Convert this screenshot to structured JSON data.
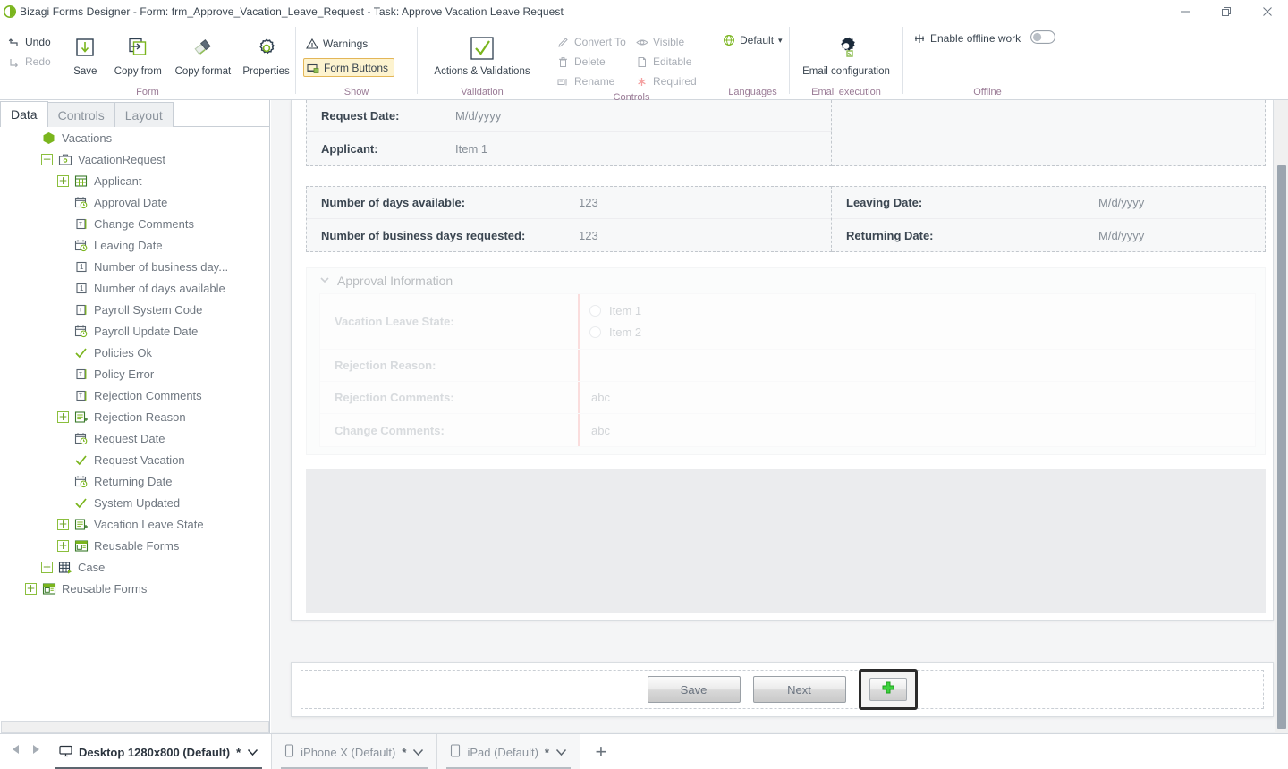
{
  "window": {
    "title": "Bizagi Forms Designer  - Form: frm_Approve_Vacation_Leave_Request - Task:  Approve Vacation Leave Request",
    "logo_icon": "bizagi-logo-icon",
    "minimize_icon": "minimize-icon",
    "restore_icon": "restore-icon",
    "close_icon": "close-icon"
  },
  "ribbon": {
    "groups": [
      {
        "label": "Form",
        "undo": "Undo",
        "redo": "Redo",
        "items": [
          {
            "label": "Save",
            "icon": "save-icon"
          },
          {
            "label": "Copy from",
            "icon": "copy-from-icon"
          },
          {
            "label": "Copy format",
            "icon": "copy-format-icon"
          },
          {
            "label": "Properties",
            "icon": "properties-gear-icon"
          }
        ]
      },
      {
        "label": "Show",
        "items": [
          {
            "label": "Warnings",
            "icon": "warning-triangle-icon"
          },
          {
            "label": "Form Buttons",
            "icon": "form-buttons-icon"
          }
        ]
      },
      {
        "label": "Validation",
        "items": [
          {
            "label": "Actions & Validations",
            "icon": "checkmark-box-icon"
          }
        ]
      },
      {
        "label": "Controls",
        "items": [
          {
            "label": "Convert To",
            "icon": "convert-to-pen-icon"
          },
          {
            "label": "Delete",
            "icon": "trash-icon"
          },
          {
            "label": "Rename",
            "icon": "rename-icon"
          },
          {
            "label": "Visible",
            "icon": "eye-icon"
          },
          {
            "label": "Editable",
            "icon": "editable-page-icon"
          },
          {
            "label": "Required",
            "icon": "asterisk-icon"
          }
        ]
      },
      {
        "label": "Languages",
        "items": [
          {
            "label": "Default",
            "icon": "globe-icon",
            "caret": "▾"
          }
        ]
      },
      {
        "label": "Email execution",
        "items": [
          {
            "label": "Email configuration",
            "icon": "email-gear-icon"
          }
        ]
      },
      {
        "label": "Offline",
        "items": [
          {
            "label": "Enable offline work",
            "icon": "offline-icon",
            "toggle": "off"
          }
        ]
      }
    ]
  },
  "left_panel": {
    "tabs": [
      {
        "label": "Data",
        "active": true
      },
      {
        "label": "Controls",
        "active": false
      },
      {
        "label": "Layout",
        "active": false
      }
    ],
    "tree": [
      {
        "label": "Vacations",
        "indent": 0,
        "expander": "",
        "icon": "entity-hex-icon"
      },
      {
        "label": "VacationRequest",
        "indent": 1,
        "expander": "-",
        "icon": "briefcase-icon"
      },
      {
        "label": "Applicant",
        "indent": 2,
        "expander": "+",
        "icon": "table-grid-icon"
      },
      {
        "label": "Approval Date",
        "indent": 2,
        "expander": "",
        "icon": "date-time-icon"
      },
      {
        "label": "Change Comments",
        "indent": 2,
        "expander": "",
        "icon": "text-field-icon"
      },
      {
        "label": "Leaving Date",
        "indent": 2,
        "expander": "",
        "icon": "date-time-icon"
      },
      {
        "label": "Number of business day...",
        "indent": 2,
        "expander": "",
        "icon": "number-icon"
      },
      {
        "label": "Number of days available",
        "indent": 2,
        "expander": "",
        "icon": "number-icon"
      },
      {
        "label": "Payroll System Code",
        "indent": 2,
        "expander": "",
        "icon": "text-field-icon"
      },
      {
        "label": "Payroll Update Date",
        "indent": 2,
        "expander": "",
        "icon": "date-time-icon"
      },
      {
        "label": "Policies Ok",
        "indent": 2,
        "expander": "",
        "icon": "boolean-check-icon"
      },
      {
        "label": "Policy Error",
        "indent": 2,
        "expander": "",
        "icon": "text-field-icon"
      },
      {
        "label": "Rejection Comments",
        "indent": 2,
        "expander": "",
        "icon": "text-field-icon"
      },
      {
        "label": "Rejection Reason",
        "indent": 2,
        "expander": "+",
        "icon": "parameter-entity-icon"
      },
      {
        "label": "Request Date",
        "indent": 2,
        "expander": "",
        "icon": "date-time-icon"
      },
      {
        "label": "Request Vacation",
        "indent": 2,
        "expander": "",
        "icon": "boolean-check-icon"
      },
      {
        "label": "Returning Date",
        "indent": 2,
        "expander": "",
        "icon": "date-time-icon"
      },
      {
        "label": "System Updated",
        "indent": 2,
        "expander": "",
        "icon": "boolean-check-icon"
      },
      {
        "label": "Vacation Leave State",
        "indent": 2,
        "expander": "+",
        "icon": "parameter-entity-icon"
      },
      {
        "label": "Reusable Forms",
        "indent": 2,
        "expander": "+",
        "icon": "reusable-forms-icon"
      },
      {
        "label": "Case",
        "indent": 1,
        "expander": "+",
        "icon": "case-icon"
      },
      {
        "label": "Reusable Forms",
        "indent": 0,
        "expander": "+",
        "icon": "reusable-forms-icon"
      }
    ]
  },
  "form": {
    "top_left_group": {
      "rows": [
        {
          "label": "Request Date:",
          "value": "M/d/yyyy"
        },
        {
          "label": "Applicant:",
          "value": "Item 1"
        }
      ]
    },
    "mid_left_group": {
      "rows": [
        {
          "label": "Number of days available:",
          "value": "123"
        },
        {
          "label": "Number of business days requested:",
          "value": "123"
        }
      ]
    },
    "mid_right_group": {
      "rows": [
        {
          "label": "Leaving Date:",
          "value": "M/d/yyyy"
        },
        {
          "label": "Returning Date:",
          "value": "M/d/yyyy"
        }
      ]
    },
    "approval_section": {
      "title": "Approval Information",
      "collapse_icon": "chevron-down-icon",
      "vacation_leave_state": {
        "label": "Vacation Leave State:",
        "options": [
          "Item 1",
          "Item 2"
        ]
      },
      "rejection_reason": {
        "label": "Rejection Reason:",
        "value": ""
      },
      "rejection_comments": {
        "label": "Rejection Comments:",
        "placeholder": "abc"
      },
      "change_comments": {
        "label": "Change Comments:",
        "placeholder": "abc"
      }
    },
    "buttons": {
      "save": "Save",
      "next": "Next",
      "add_icon": "add-plus-icon"
    }
  },
  "device_bar": {
    "prev_icon": "prev-arrow-icon",
    "next_icon": "next-arrow-icon",
    "tabs": [
      {
        "label": "Desktop 1280x800 (Default)",
        "star": "*",
        "icon": "desktop-icon",
        "active": true
      },
      {
        "label": "iPhone X (Default)",
        "star": "*",
        "icon": "phone-icon",
        "active": false
      },
      {
        "label": "iPad (Default)",
        "star": "*",
        "icon": "tablet-icon",
        "active": false
      }
    ],
    "add_label": "+"
  },
  "colors": {
    "accent_green": "#7ab51d",
    "ribbon_group_label": "#9a7b96",
    "highlight_bg": "#fdf3cf",
    "highlight_border": "#e3b657",
    "required_red": "#f2a8a8",
    "scrollbar_thumb": "#9ba5af"
  }
}
